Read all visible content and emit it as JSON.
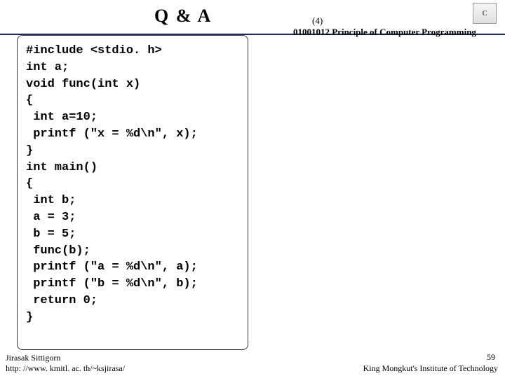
{
  "title": "Q & A",
  "slide_marker": "(4)",
  "course_code": "01001012 Principle of Computer Programming",
  "badge": "C",
  "code_lines": [
    "#include <stdio. h>",
    "int a;",
    "void func(int x)",
    "{",
    " int a=10;",
    " printf (\"x = %d\\n\", x);",
    "}",
    "int main()",
    "{",
    " int b;",
    " a = 3;",
    " b = 5;",
    " func(b);",
    " printf (\"a = %d\\n\", a);",
    " printf (\"b = %d\\n\", b);",
    " return 0;",
    "}"
  ],
  "footer": {
    "author": "Jirasak Sittigorn",
    "url": "http: //www. kmitl. ac. th/~ksjirasa/",
    "page_num": "59",
    "institution": "King Mongkut's Institute of Technology"
  }
}
